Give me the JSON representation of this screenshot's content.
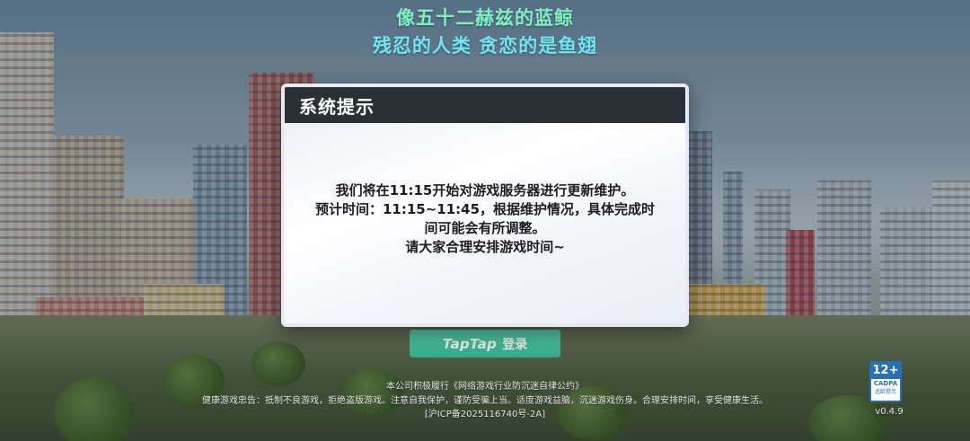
{
  "slogan": {
    "line1": "像五十二赫兹的蓝鲸",
    "line2": "残忍的人类 贪恋的是鱼翅"
  },
  "dialog": {
    "title": "系统提示",
    "lines": [
      "我们将在11:15开始对游戏服务器进行更新维护。",
      "预计时间：11:15~11:45，根据维护情况，具体完成时",
      "间可能会有所调整。",
      "请大家合理安排游戏时间~"
    ]
  },
  "login": {
    "logo": "TapTap",
    "label": "登录"
  },
  "footer": {
    "compliance": "本公司积极履行《网络游戏行业防沉迷自律公约》",
    "health_advice": "健康游戏忠告：抵制不良游戏，拒绝盗版游戏。注意自我保护，谨防受骗上当。适度游戏益脑，沉迷游戏伤身。合理安排时间，享受健康生活。",
    "icp": "[沪ICP备2025116740号-2A]"
  },
  "age_rating": {
    "age": "12+",
    "org": "CADPA",
    "tip": "适龄提示"
  },
  "version": "v0.4.9",
  "colors": {
    "dialog_header": "#2b2f36",
    "login_button": "#3cc4a3",
    "slogan_line1": "#7ff0c4",
    "slogan_line2": "#6fe6f2"
  }
}
